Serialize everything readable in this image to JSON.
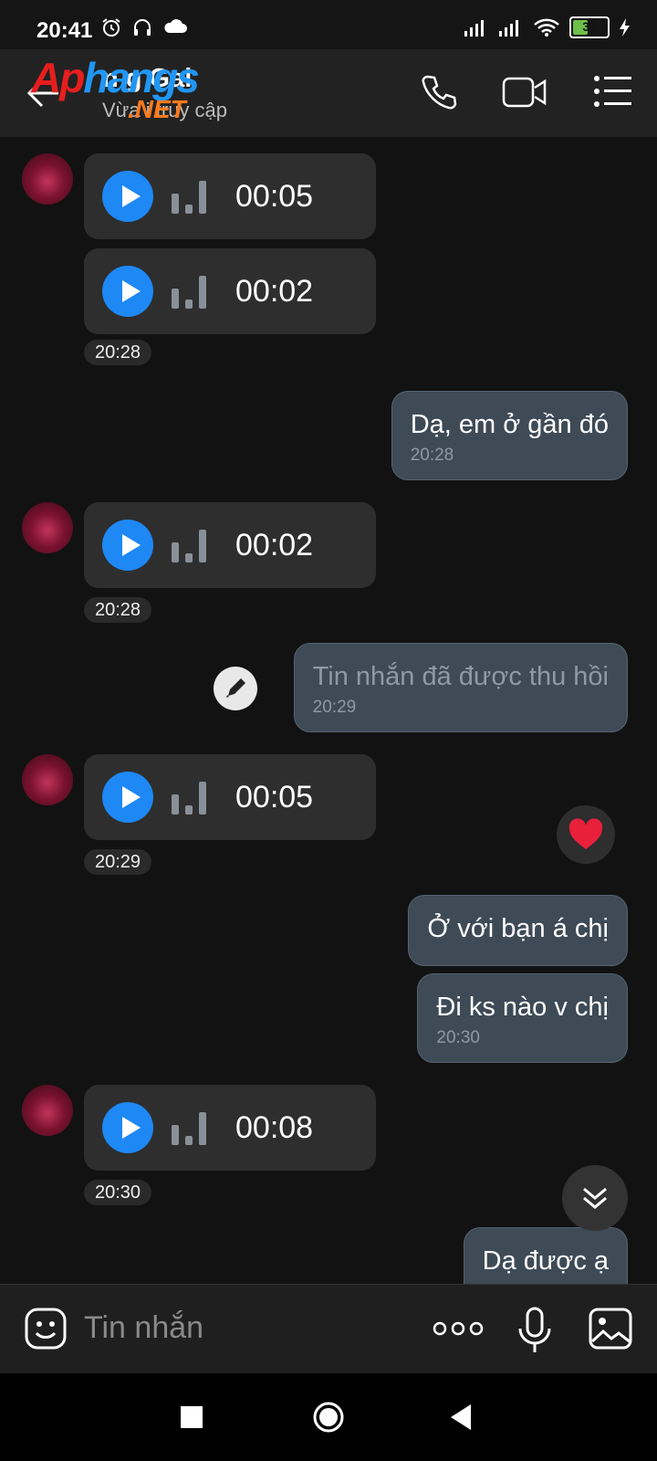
{
  "status_bar": {
    "time": "20:41",
    "battery": "37"
  },
  "header": {
    "title": "n g Gai",
    "subtitle": "Vừa   i truy cập"
  },
  "watermark": {
    "part1": "Ap",
    "part2": "hangs",
    "part3": ".NET"
  },
  "messages": {
    "m1": {
      "duration": "00:05"
    },
    "m2": {
      "duration": "00:02"
    },
    "t1": "20:28",
    "m3": {
      "text": "Dạ, em ở gần đó",
      "time": "20:28"
    },
    "m4": {
      "duration": "00:02"
    },
    "t2": "20:28",
    "m5": {
      "text": "Tin nhắn đã được thu hồi",
      "time": "20:29"
    },
    "m6": {
      "duration": "00:05"
    },
    "t3": "20:29",
    "m7": {
      "text": "Ở với bạn á chị"
    },
    "m8": {
      "text": "Đi ks nào v chị",
      "time": "20:30"
    },
    "m9": {
      "duration": "00:08"
    },
    "t4": "20:30",
    "m10": {
      "text": "Dạ được ạ"
    }
  },
  "input": {
    "placeholder": "Tin nhắn"
  },
  "colors": {
    "accent": "#1e88f5",
    "outgoing_bubble": "#3e4a56",
    "incoming_bubble": "#2e2e2e"
  }
}
